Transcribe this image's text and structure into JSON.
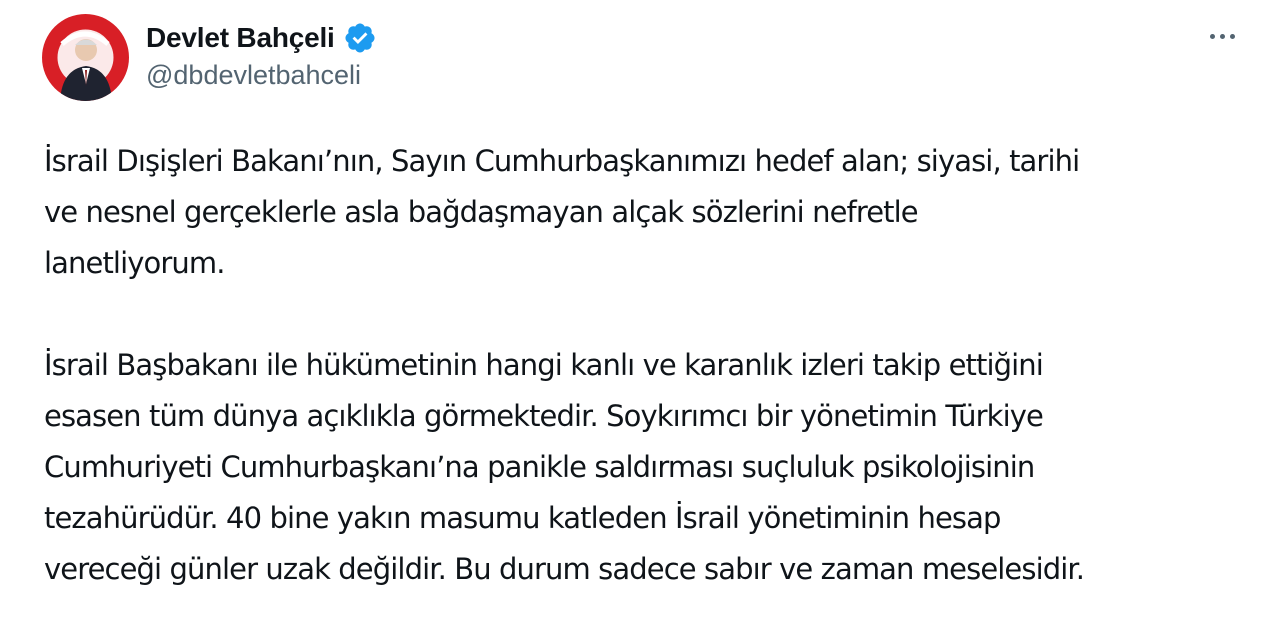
{
  "tweet": {
    "author": {
      "display_name": "Devlet Bahçeli",
      "handle": "@dbdevletbahceli",
      "avatar_icon": "profile-photo",
      "verified_icon": "verified-badge-icon",
      "verified_color": "#1d9bf0"
    },
    "more_icon": "more-horizontal-icon",
    "paragraphs": [
      {
        "lines": [
          "İsrail Dışişleri Bakanı’nın, Sayın Cumhurbaşkanımızı hedef alan; siyasi, tarihi",
          "ve nesnel gerçeklerle asla bağdaşmayan alçak sözlerini nefretle",
          "lanetliyorum."
        ]
      },
      {
        "lines": [
          "İsrail Başbakanı ile hükümetinin hangi kanlı ve karanlık izleri takip ettiğini",
          "esasen tüm dünya açıklıkla görmektedir. Soykırımcı bir yönetimin Türkiye",
          "Cumhuriyeti Cumhurbaşkanı’na panikle saldırması suçluluk psikolojisinin",
          "tezahürüdür. 40 bine yakın masumu katleden İsrail yönetiminin hesap",
          "vereceği günler uzak değildir. Bu durum sadece sabır ve zaman meselesidir."
        ]
      }
    ]
  }
}
